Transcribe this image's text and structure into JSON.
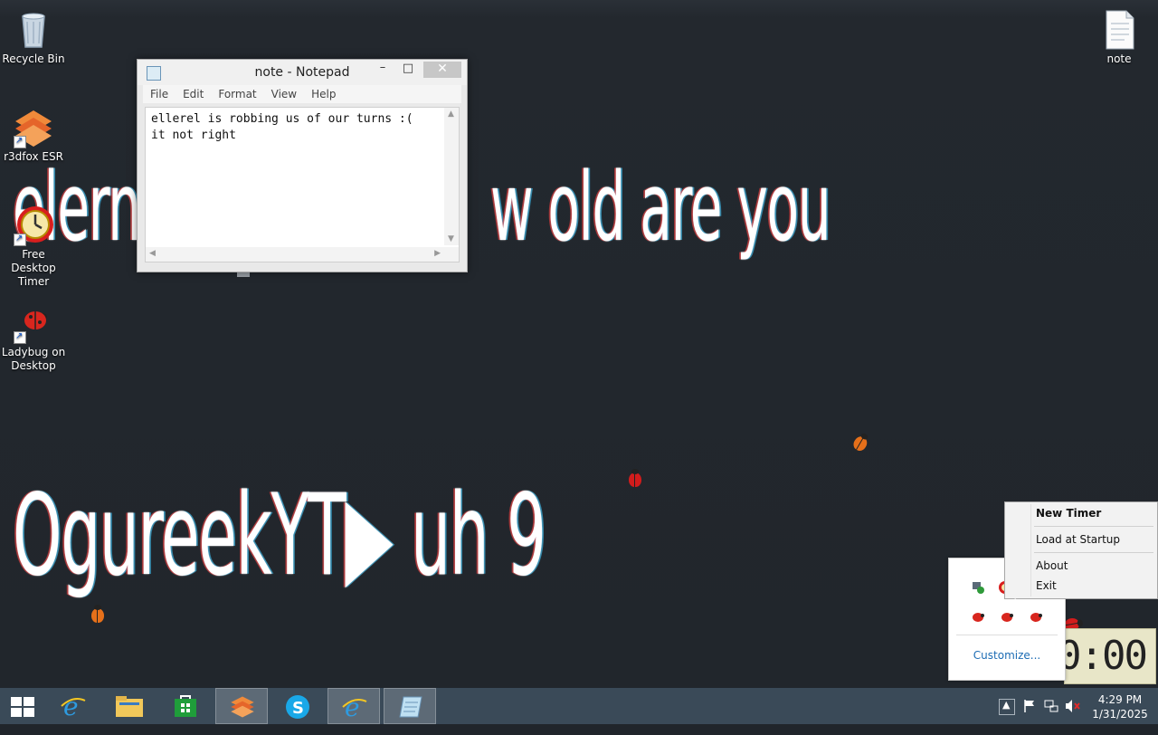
{
  "desktop": {
    "overlay_line1_a": "elerne",
    "overlay_line1_b": "w old are you",
    "overlay_line2": "OgureekYT▶ uh 9",
    "icons": [
      {
        "label": "Recycle Bin",
        "icon": "recycle-bin-icon"
      },
      {
        "label": "r3dfox ESR",
        "icon": "r3dfox-icon"
      },
      {
        "label": "Free Desktop Timer",
        "icon": "alarm-clock-icon"
      },
      {
        "label": "Ladybug on Desktop",
        "icon": "ladybug-icon"
      },
      {
        "label": "note",
        "icon": "text-file-icon"
      }
    ]
  },
  "notepad": {
    "title": "note - Notepad",
    "menu": [
      "File",
      "Edit",
      "Format",
      "View",
      "Help"
    ],
    "content": "ellerel is robbing us of our turns :(\nit not right",
    "controls": {
      "minimize": "–",
      "maximize": "□",
      "close": "✕"
    }
  },
  "tray_flyout": {
    "customize_label": "Customize..."
  },
  "context_menu": {
    "items": [
      "New Timer",
      "Load at Startup",
      "About",
      "Exit"
    ]
  },
  "timer_widget": {
    "display": "0:00"
  },
  "taskbar": {
    "apps": [
      "Start",
      "Internet Explorer",
      "File Explorer",
      "Store",
      "r3dfox ESR",
      "Skype",
      "Internet Explorer",
      "Notepad"
    ],
    "clock_time": "4:29 PM",
    "clock_date": "1/31/2025"
  },
  "colors": {
    "desktop_bg": "#21262c",
    "taskbar_bg": "#3a4a58",
    "link_blue": "#1c6cb4"
  }
}
